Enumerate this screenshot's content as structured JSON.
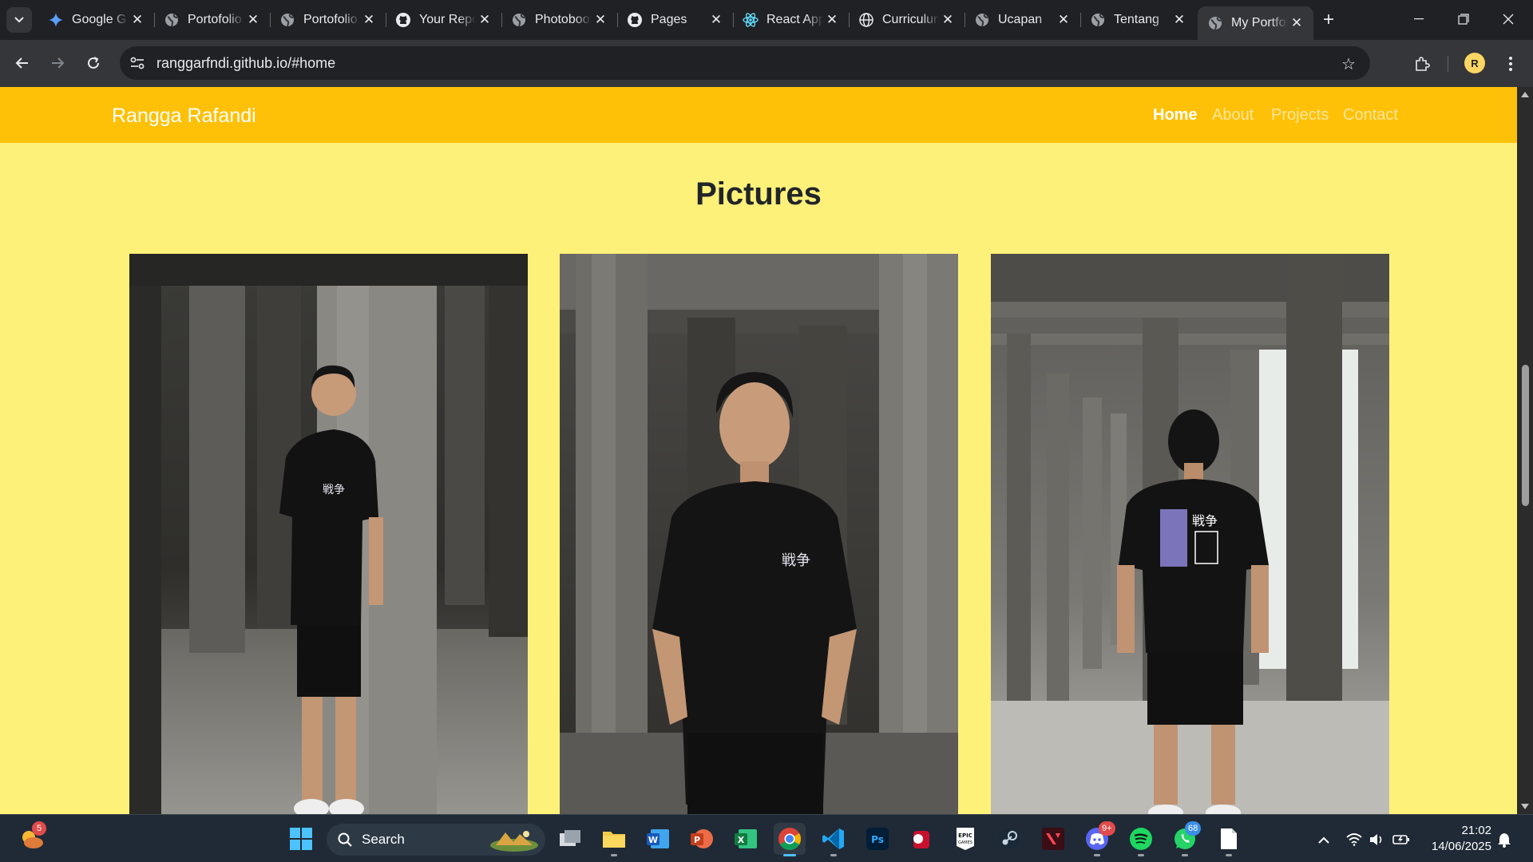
{
  "browser": {
    "tabs": [
      {
        "title": "Google G",
        "icon": "gemini-icon"
      },
      {
        "title": "Portofolio",
        "icon": "globe-icon"
      },
      {
        "title": "Portofolio",
        "icon": "globe-icon"
      },
      {
        "title": "Your Repositories",
        "icon": "github-icon"
      },
      {
        "title": "Photobooth",
        "icon": "globe-icon"
      },
      {
        "title": "Pages",
        "icon": "github-icon"
      },
      {
        "title": "React App",
        "icon": "react-icon"
      },
      {
        "title": "Curriculum",
        "icon": "globe-outline-icon"
      },
      {
        "title": "Ucapan",
        "icon": "globe-icon"
      },
      {
        "title": "Tentang",
        "icon": "globe-icon"
      },
      {
        "title": "My Portfolio",
        "icon": "globe-icon",
        "active": true
      }
    ],
    "url": "ranggarfndi.github.io/#home",
    "profile_initial": "R"
  },
  "page": {
    "brand": "Rangga Rafandi",
    "nav": [
      "Home",
      "About",
      "Projects",
      "Contact"
    ],
    "active_nav": "Home",
    "section_title": "Pictures",
    "pictures": [
      {
        "subject": "photo-man-leaning-pillar"
      },
      {
        "subject": "photo-man-front-hands-in-pockets"
      },
      {
        "subject": "photo-man-back-view"
      }
    ],
    "colors": {
      "navbar": "#ffc107",
      "background": "#fef17a",
      "title": "#212529"
    }
  },
  "taskbar": {
    "search_label": "Search",
    "weather_badge": "5",
    "discord_badge": "9+",
    "whatsapp_badge": "68",
    "time": "21:02",
    "date": "14/06/2025"
  }
}
